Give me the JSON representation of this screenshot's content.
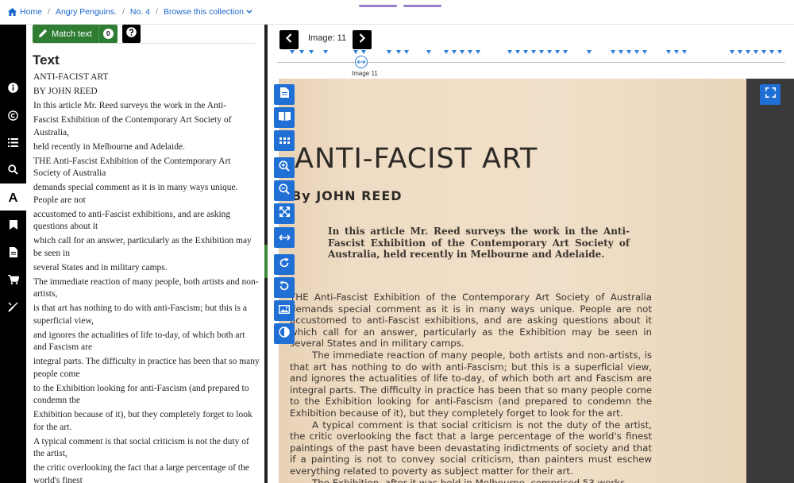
{
  "breadcrumb": {
    "home": "Home",
    "collection": "Angry Penguins.",
    "issue": "No. 4",
    "browse": "Browse this collection"
  },
  "text_panel": {
    "match_text_label": "Match text",
    "match_count": "0",
    "heading": "Text",
    "lines": [
      "ANTI-FACIST ART",
      "BY JOHN REED",
      "In this article Mr. Reed surveys the work in the Anti-",
      "Fascist Exhibition of the Contemporary Art Society of Australia,",
      "held recently in Melbourne and Adelaide.",
      "THE Anti-Fascist Exhibition of the Contemporary Art Society of Australia",
      "demands special comment as it is in many ways unique. People are not",
      "accustomed to anti-Fascist exhibitions, and are asking questions about it",
      "which call for an answer, particularly as the Exhibition may be seen in",
      "several States and in military camps.",
      "The immediate reaction of many people, both artists and non-artists,",
      "is that art has nothing to do with anti-Fascism; but this is a superficial view,",
      "and ignores the actualities of life to-day, of which both art and Fascism are",
      "integral parts. The difficulty in practice has been that so many people come",
      "to the Exhibition looking for anti-Fascism (and prepared to condemn the",
      "Exhibition because of it), but they completely forget to look for the art.",
      "A typical comment is that social criticism is not the duty of the artist,",
      "the critic overlooking the fact that a large percentage of the world's finest"
    ]
  },
  "viewer": {
    "image_label": "Image: 11",
    "marker_label": "Image 11",
    "scan": {
      "title": "ANTI-FACIST  ART",
      "byline": "By JOHN REED",
      "intro": "In this article Mr. Reed surveys the work in the Anti-Fascist Exhibition of the Contemporary Art Society of Australia, held recently in Melbourne and Adelaide.",
      "body": [
        "THE Anti-Fascist Exhibition of the Contemporary Art Society of Australia demands special comment as it is in many ways unique. People are not accustomed to anti-Fascist exhibitions, and are asking questions about it which call for an answer, particularly as the Exhibition may be seen in several States and in military camps.",
        "The immediate reaction of many people, both artists and non-artists, is that art has nothing to do with anti-Fascism; but this is a superficial view, and ignores the actualities of life to-day, of which both art and Fascism are integral parts. The difficulty in practice has been that so many people come to the Exhibition looking for anti-Fascism (and prepared to condemn the Exhibition because of it), but they completely forget to look for the art.",
        "A typical comment is that social criticism is not the duty of the artist, the critic overlooking the fact that a large percentage of the world's finest paintings of the past have been devastating indictments of society and that if a painting is not to convey social criticism, than painters must eschew everything related to poverty as subject matter for their art.",
        "The Exhibition, after it was held in Melbourne, comprised 53 works"
      ]
    }
  },
  "colors": {
    "accent_blue": "#1f6fd4",
    "match_green": "#2e7d32",
    "rail_black": "#000000"
  },
  "icons": [
    "home-icon",
    "chevron-down-icon",
    "pencil-icon",
    "help-icon",
    "info-icon",
    "copyright-icon",
    "list-icon",
    "search-icon",
    "text-icon",
    "bookmark-icon",
    "document-icon",
    "cart-icon",
    "tools-icon",
    "chevron-left-icon",
    "chevron-right-icon",
    "page-icon",
    "book-icon",
    "grid-icon",
    "zoom-in-icon",
    "zoom-out-icon",
    "fit-icon",
    "fit-width-icon",
    "rotate-right-icon",
    "rotate-left-icon",
    "image-icon",
    "contrast-icon",
    "fullscreen-icon"
  ]
}
